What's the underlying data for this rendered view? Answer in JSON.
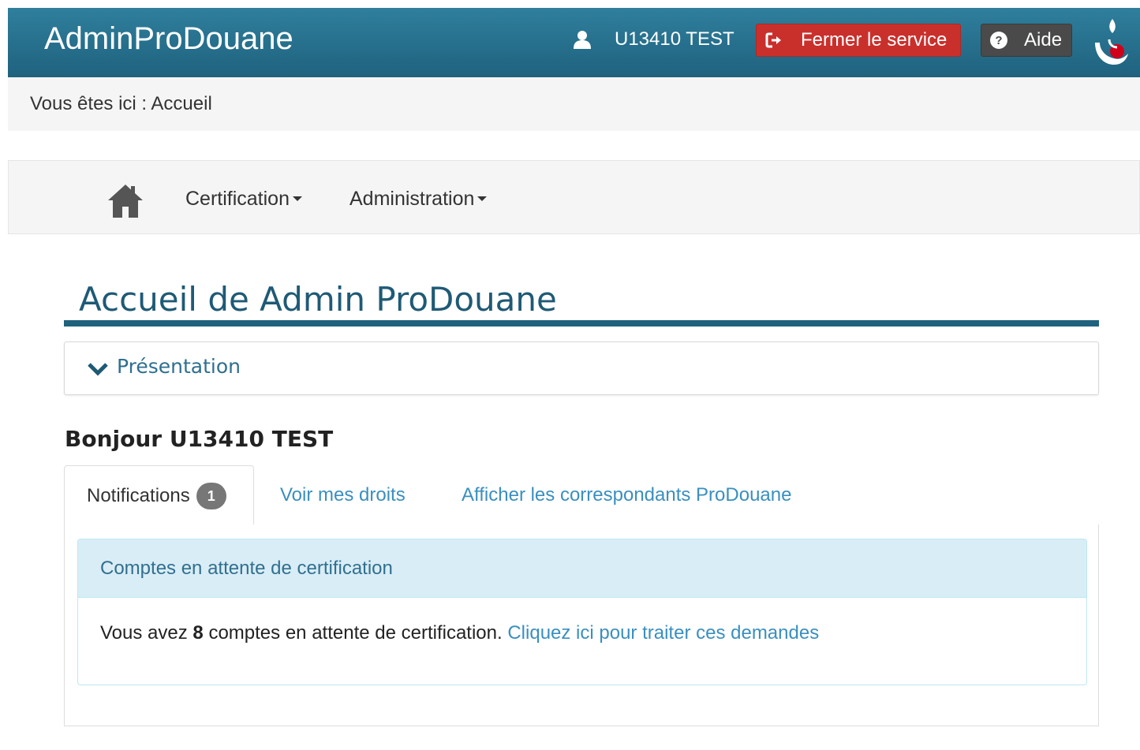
{
  "header": {
    "brand": "AdminProDouane",
    "user_name": "U13410 TEST",
    "close_label": "Fermer le service",
    "help_label": "Aide"
  },
  "breadcrumb": {
    "text": "Vous êtes ici : Accueil"
  },
  "nav": {
    "items": [
      {
        "label": "Certification"
      },
      {
        "label": "Administration"
      }
    ]
  },
  "main": {
    "title": "Accueil de Admin ProDouane",
    "presentation_label": "Présentation",
    "greeting": "Bonjour U13410 TEST",
    "tabs": [
      {
        "label": "Notifications",
        "badge": "1"
      },
      {
        "label": "Voir mes droits"
      },
      {
        "label": "Afficher les correspondants ProDouane"
      }
    ],
    "notification": {
      "heading": "Comptes en attente de certification",
      "text_prefix": "Vous avez",
      "count": "8",
      "text_suffix": "comptes en attente de certification.",
      "link": "Cliquez ici pour traiter ces demandes"
    }
  },
  "icons": {
    "user": "user-icon",
    "close": "sign-out-icon",
    "help": "question-circle-icon",
    "home": "home-icon",
    "chevron": "chevron-down-icon",
    "logo": "douane-logo"
  },
  "colors": {
    "header": "#1f627e",
    "close_button": "#c9302c",
    "help_button": "#4a4a4a",
    "link": "#3a8fbf",
    "info_heading_bg": "#d9edf7"
  }
}
